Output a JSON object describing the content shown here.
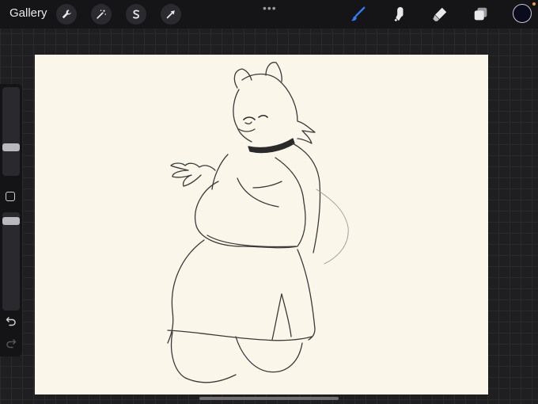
{
  "app": {
    "gallery_label": "Gallery"
  },
  "toolbar_left": [
    {
      "name": "actions",
      "icon": "wrench-icon"
    },
    {
      "name": "adjustments",
      "icon": "magic-wand-icon"
    },
    {
      "name": "selection",
      "icon": "selection-icon"
    },
    {
      "name": "transform",
      "icon": "transform-arrow-icon"
    }
  ],
  "toolbar_right": [
    {
      "name": "brush",
      "icon": "brush-icon",
      "active": true
    },
    {
      "name": "smudge",
      "icon": "smudge-icon"
    },
    {
      "name": "eraser",
      "icon": "eraser-icon"
    },
    {
      "name": "layers",
      "icon": "layers-icon"
    }
  ],
  "more_label": "•••",
  "colors": {
    "accent": "#2f7cf6",
    "current_color": "#0b0b1e",
    "canvas": "#faf6ea"
  },
  "sidebar": {
    "brush_size_level": 0.3,
    "brush_opacity_level": 0.95
  }
}
